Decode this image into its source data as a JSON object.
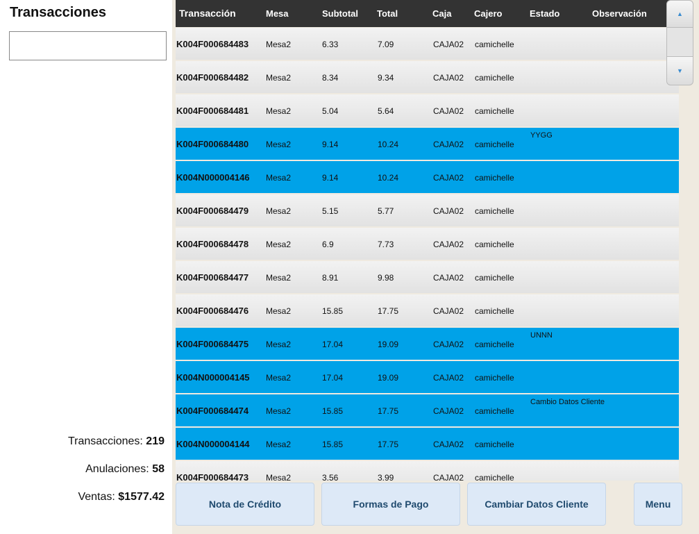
{
  "title": "Transacciones",
  "search": {
    "value": "",
    "placeholder": ""
  },
  "stats": {
    "transacciones_label": "Transacciones:",
    "transacciones_value": "219",
    "anulaciones_label": "Anulaciones:",
    "anulaciones_value": "58",
    "ventas_label": "Ventas:",
    "ventas_value": "$1577.42"
  },
  "table": {
    "headers": [
      "Transacción",
      "Mesa",
      "Subtotal",
      "Total",
      "Caja",
      "Cajero",
      "Estado",
      "Observación"
    ],
    "rows": [
      {
        "trans": "K004F000684483",
        "mesa": "Mesa2",
        "subtotal": "6.33",
        "total": "7.09",
        "caja": "CAJA02",
        "cajero": "camichelle",
        "obs": "",
        "selected": false
      },
      {
        "trans": "K004F000684482",
        "mesa": "Mesa2",
        "subtotal": "8.34",
        "total": "9.34",
        "caja": "CAJA02",
        "cajero": "camichelle",
        "obs": "",
        "selected": false
      },
      {
        "trans": "K004F000684481",
        "mesa": "Mesa2",
        "subtotal": "5.04",
        "total": "5.64",
        "caja": "CAJA02",
        "cajero": "camichelle",
        "obs": "",
        "selected": false
      },
      {
        "trans": "K004F000684480",
        "mesa": "Mesa2",
        "subtotal": "9.14",
        "total": "10.24",
        "caja": "CAJA02",
        "cajero": "camichelle",
        "obs": "YYGG",
        "selected": true
      },
      {
        "trans": "K004N000004146",
        "mesa": "Mesa2",
        "subtotal": "9.14",
        "total": "10.24",
        "caja": "CAJA02",
        "cajero": "camichelle",
        "obs": "",
        "selected": true
      },
      {
        "trans": "K004F000684479",
        "mesa": "Mesa2",
        "subtotal": "5.15",
        "total": "5.77",
        "caja": "CAJA02",
        "cajero": "camichelle",
        "obs": "",
        "selected": false
      },
      {
        "trans": "K004F000684478",
        "mesa": "Mesa2",
        "subtotal": "6.9",
        "total": "7.73",
        "caja": "CAJA02",
        "cajero": "camichelle",
        "obs": "",
        "selected": false
      },
      {
        "trans": "K004F000684477",
        "mesa": "Mesa2",
        "subtotal": "8.91",
        "total": "9.98",
        "caja": "CAJA02",
        "cajero": "camichelle",
        "obs": "",
        "selected": false
      },
      {
        "trans": "K004F000684476",
        "mesa": "Mesa2",
        "subtotal": "15.85",
        "total": "17.75",
        "caja": "CAJA02",
        "cajero": "camichelle",
        "obs": "",
        "selected": false
      },
      {
        "trans": "K004F000684475",
        "mesa": "Mesa2",
        "subtotal": "17.04",
        "total": "19.09",
        "caja": "CAJA02",
        "cajero": "camichelle",
        "obs": "UNNN",
        "selected": true
      },
      {
        "trans": "K004N000004145",
        "mesa": "Mesa2",
        "subtotal": "17.04",
        "total": "19.09",
        "caja": "CAJA02",
        "cajero": "camichelle",
        "obs": "",
        "selected": true
      },
      {
        "trans": "K004F000684474",
        "mesa": "Mesa2",
        "subtotal": "15.85",
        "total": "17.75",
        "caja": "CAJA02",
        "cajero": "camichelle",
        "obs": "Cambio Datos Cliente",
        "selected": true
      },
      {
        "trans": "K004N000004144",
        "mesa": "Mesa2",
        "subtotal": "15.85",
        "total": "17.75",
        "caja": "CAJA02",
        "cajero": "camichelle",
        "obs": "",
        "selected": true
      },
      {
        "trans": "K004F000684473",
        "mesa": "Mesa2",
        "subtotal": "3.56",
        "total": "3.99",
        "caja": "CAJA02",
        "cajero": "camichelle",
        "obs": "",
        "selected": false
      }
    ]
  },
  "scroll": {
    "up_icon": "triangle-up-icon",
    "down_icon": "triangle-down-icon"
  },
  "colors": {
    "header_bg": "#333333",
    "selected_row": "#00a2e8",
    "button_bg": "#dde9f7",
    "button_text": "#1f4a6e"
  },
  "buttons": {
    "nota": "Nota de Crédito",
    "formas": "Formas de Pago",
    "cambiar": "Cambiar Datos Cliente",
    "menu": "Menu"
  }
}
